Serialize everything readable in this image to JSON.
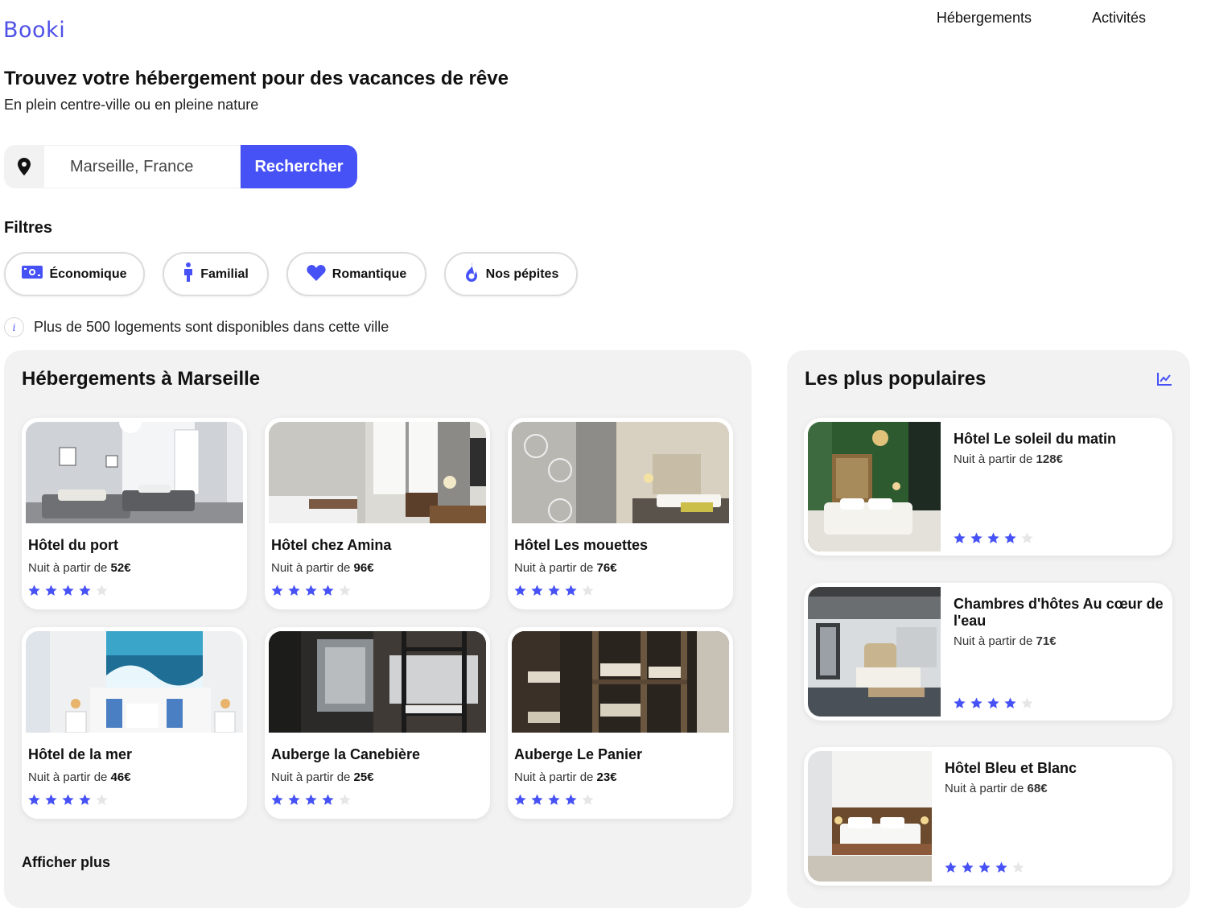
{
  "header": {
    "logo": "Booki",
    "nav": [
      "Hébergements",
      "Activités"
    ]
  },
  "hero": {
    "title": "Trouvez votre hébergement pour des vacances de rêve",
    "subtitle": "En plein centre-ville ou en pleine nature"
  },
  "search": {
    "value": "Marseille, France",
    "button": "Rechercher",
    "icon": "map-pin-icon"
  },
  "filters": {
    "title": "Filtres",
    "items": [
      {
        "label": "Économique",
        "icon": "money-icon"
      },
      {
        "label": "Familial",
        "icon": "person-icon"
      },
      {
        "label": "Romantique",
        "icon": "heart-icon"
      },
      {
        "label": "Nos pépites",
        "icon": "fire-icon"
      }
    ]
  },
  "info": {
    "icon": "info-icon",
    "text": "Plus de 500 logements sont disponibles dans cette ville"
  },
  "colors": {
    "accent": "#4752f6",
    "logo": "#4f51e8",
    "panel": "#f2f2f2",
    "star_off": "#e6e6e6"
  },
  "accommodations": {
    "title": "Hébergements à Marseille",
    "more": "Afficher plus",
    "price_prefix": "Nuit à partir de ",
    "items": [
      {
        "name": "Hôtel du port",
        "price": "52€",
        "rating": 4
      },
      {
        "name": "Hôtel chez Amina",
        "price": "96€",
        "rating": 4
      },
      {
        "name": "Hôtel Les mouettes",
        "price": "76€",
        "rating": 4
      },
      {
        "name": "Hôtel de la mer",
        "price": "46€",
        "rating": 4
      },
      {
        "name": "Auberge la Canebière",
        "price": "25€",
        "rating": 4
      },
      {
        "name": "Auberge Le Panier",
        "price": "23€",
        "rating": 4
      }
    ]
  },
  "popular": {
    "title": "Les plus populaires",
    "icon": "trend-chart-icon",
    "items": [
      {
        "name": "Hôtel Le soleil du matin",
        "price": "128€",
        "rating": 4
      },
      {
        "name": "Chambres d'hôtes Au cœur de l'eau",
        "price": "71€",
        "rating": 4
      },
      {
        "name": "Hôtel Bleu et Blanc",
        "price": "68€",
        "rating": 4
      }
    ]
  }
}
